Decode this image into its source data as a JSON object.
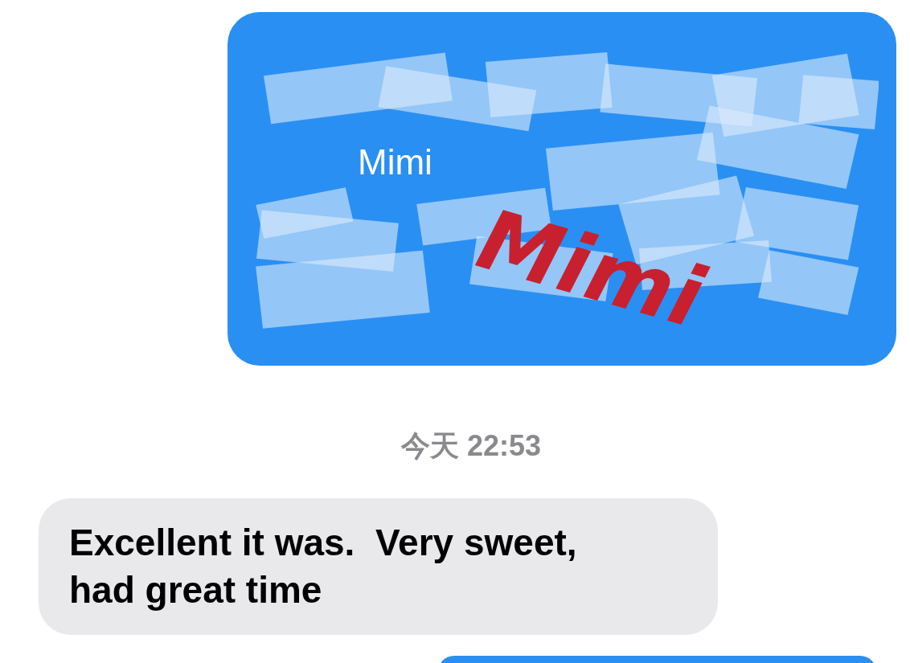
{
  "messages": [
    {
      "kind": "outgoing",
      "text": "Mimi",
      "annotation": "Mimi",
      "scribbled": true
    },
    {
      "kind": "timestamp",
      "text": "今天 22:53"
    },
    {
      "kind": "incoming",
      "text": "Excellent it was.  Very sweet, had great time"
    },
    {
      "kind": "outgoing"
    }
  ]
}
